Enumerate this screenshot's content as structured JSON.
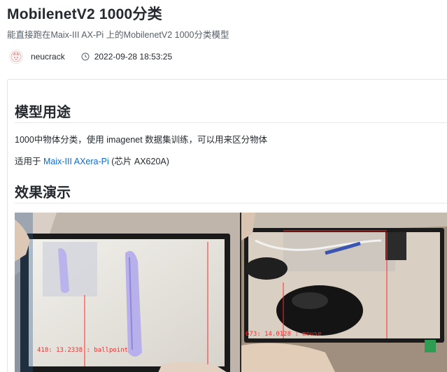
{
  "header": {
    "title": "MobilenetV2 1000分类",
    "subtitle": "能直接跑在Maix-III AX-Pi 上的MobilenetV2 1000分类模型",
    "author": "neucrack",
    "date": "2022-09-28 18:53:25"
  },
  "readme": {
    "section_usage": "模型用途",
    "usage_text": "1000中物体分类，使用 imagenet 数据集训练，可以用来区分物体",
    "applies_prefix": "适用于 ",
    "applies_link": "Maix-III AXera-Pi",
    "applies_suffix": " (芯片 AX620A)",
    "section_demo": "效果演示"
  },
  "demo": {
    "left_overlay": "418: 13.2338 : ballpoint",
    "right_overlay": "673: 14.0128 : mouse"
  },
  "colors": {
    "link": "#0969da",
    "overlay_red": "#ff2a2a",
    "text": "#24292f"
  },
  "icons": {
    "author_avatar": "avatar-icon",
    "date": "clock-icon"
  }
}
